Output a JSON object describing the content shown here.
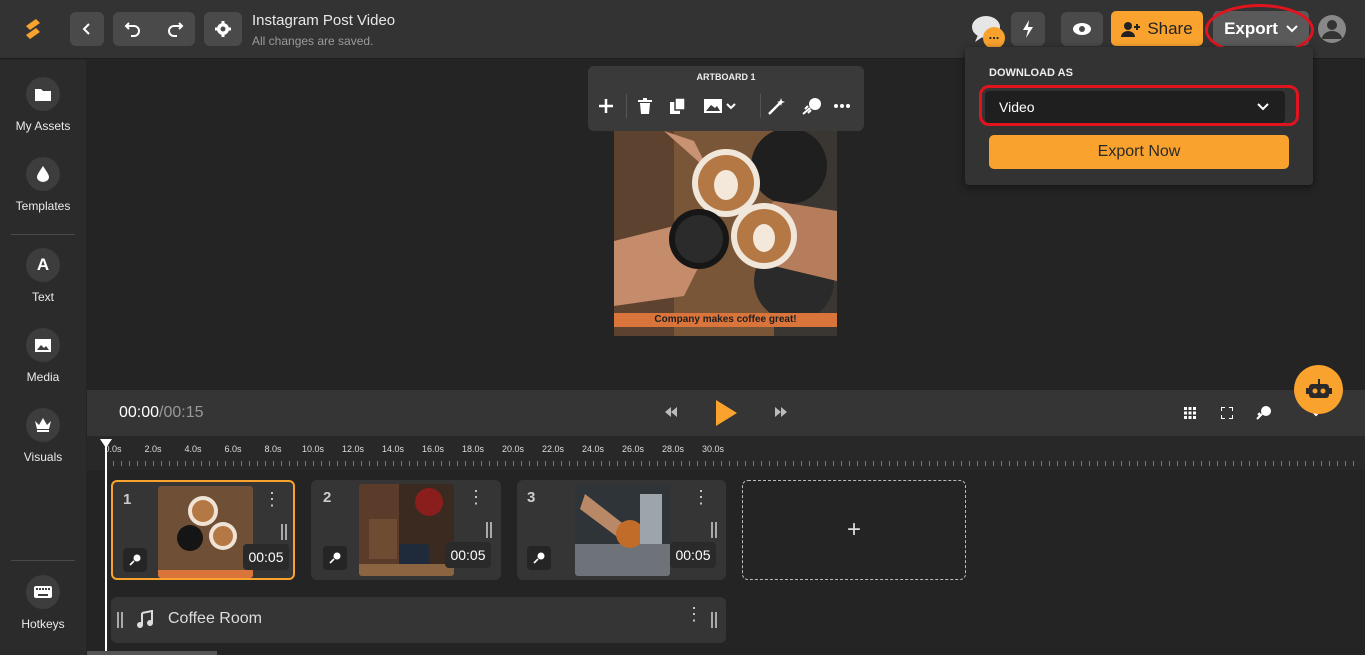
{
  "header": {
    "project_title": "Instagram Post Video",
    "save_status": "All changes are saved.",
    "share_label": "Share",
    "export_label": "Export",
    "chat_badge": "..."
  },
  "sidebar": {
    "items": [
      {
        "label": "My Assets",
        "icon": "folder-icon"
      },
      {
        "label": "Templates",
        "icon": "drop-icon"
      },
      {
        "label": "Text",
        "icon": "text-icon"
      },
      {
        "label": "Media",
        "icon": "image-icon"
      },
      {
        "label": "Visuals",
        "icon": "crown-icon"
      },
      {
        "label": "Hotkeys",
        "icon": "keyboard-icon"
      }
    ]
  },
  "artboard": {
    "label": "ARTBOARD 1",
    "caption": "Company makes coffee great!"
  },
  "export_panel": {
    "download_as_label": "DOWNLOAD AS",
    "selected_format": "Video",
    "export_now_label": "Export Now"
  },
  "timeline": {
    "current_time": "00:00",
    "separator": "/",
    "total_time": "00:15",
    "ticks": [
      "0.0s",
      "2.0s",
      "4.0s",
      "6.0s",
      "8.0s",
      "10.0s",
      "12.0s",
      "14.0s",
      "16.0s",
      "18.0s",
      "20.0s",
      "22.0s",
      "24.0s",
      "26.0s",
      "28.0s",
      "30.0s"
    ],
    "clips": [
      {
        "number": "1",
        "duration": "00:05"
      },
      {
        "number": "2",
        "duration": "00:05"
      },
      {
        "number": "3",
        "duration": "00:05"
      }
    ],
    "add_clip_label": "+",
    "audio_track": "Coffee Room"
  },
  "colors": {
    "accent": "#f9a22e",
    "highlight": "#e0141e"
  }
}
